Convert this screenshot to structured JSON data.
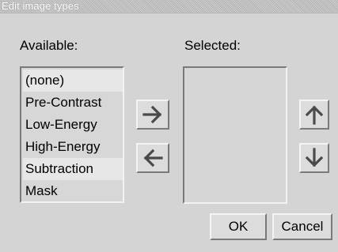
{
  "window": {
    "title": "Edit image types"
  },
  "labels": {
    "available": "Available:",
    "selected": "Selected:"
  },
  "available_items": [
    "(none)",
    "Pre-Contrast",
    "Low-Energy",
    "High-Energy",
    "Subtraction",
    "Mask"
  ],
  "selected_items": [],
  "buttons": {
    "add": "arrow-right-icon",
    "remove": "arrow-left-icon",
    "move_up": "arrow-up-icon",
    "move_down": "arrow-down-icon",
    "ok": "OK",
    "cancel": "Cancel"
  },
  "colors": {
    "background": "#d4d4d4",
    "list_background": "#d7d7d7",
    "arrow": "#4a4a4a"
  }
}
